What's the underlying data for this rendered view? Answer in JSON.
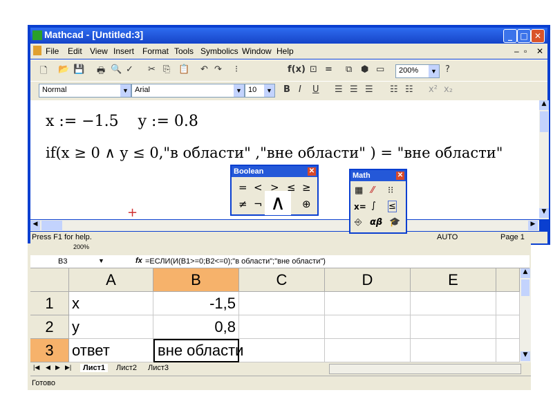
{
  "mathcad": {
    "title": "Mathcad - [Untitled:3]",
    "menu": [
      "File",
      "Edit",
      "View",
      "Insert",
      "Format",
      "Tools",
      "Symbolics",
      "Window",
      "Help"
    ],
    "toolbar": {
      "zoom": "200%",
      "style": "Normal",
      "font": "Arial",
      "size": "10"
    },
    "doc": {
      "line1": "x := −1.5    y := 0.8",
      "line2": "if(x ≥ 0 ∧ y ≤ 0,\"в области\" ,\"вне области\" ) = \"вне области\""
    },
    "status": {
      "help": "Press F1 for help.",
      "mode": "AUTO",
      "page": "Page 1"
    },
    "boolean_palette": {
      "title": "Boolean",
      "row1": [
        "=",
        "<",
        ">",
        "≤",
        "≥"
      ],
      "row2": [
        "≠",
        "¬",
        "∧",
        "⊕"
      ]
    },
    "math_palette": {
      "title": "Math",
      "items": [
        "x=",
        "αβ"
      ]
    }
  },
  "excel": {
    "name_box": "B3",
    "formula": "=ЕСЛИ(И(B1>=0;B2<=0);\"в области\";\"вне области\")",
    "columns": [
      "A",
      "B",
      "C",
      "D",
      "E"
    ],
    "rows": [
      {
        "num": "1",
        "a": "x",
        "b": "-1,5"
      },
      {
        "num": "2",
        "a": "y",
        "b": "0,8"
      },
      {
        "num": "3",
        "a": "ответ",
        "b": "вне области"
      }
    ],
    "sheets": [
      "Лист1",
      "Лист2",
      "Лист3"
    ],
    "status": "Готово",
    "zoom": "200%"
  },
  "colors": {
    "selected_header": "#f6b26b",
    "titlebar": "#1746c9",
    "active_cell_border": "#000000"
  }
}
